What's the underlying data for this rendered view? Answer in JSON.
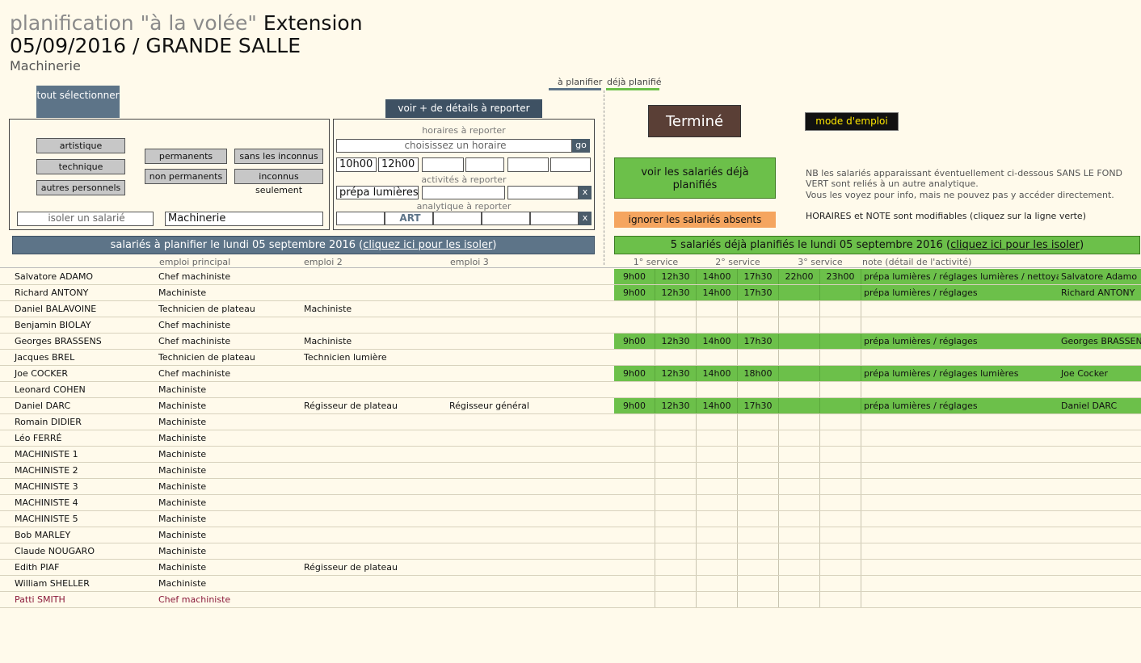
{
  "header": {
    "title_grey": "planification \"à la volée\"",
    "title_black": "Extension",
    "date_line": "05/09/2016 / GRANDE SALLE",
    "service": "Machinerie"
  },
  "legend": {
    "to_plan": "à planifier",
    "planned": "déjà planifié",
    "to_plan_color": "#5d7488",
    "planned_color": "#6cc04a"
  },
  "filters": {
    "select_all": "tout sélectionner",
    "details_tab": "voir + de détails à reporter",
    "categories": [
      "artistique",
      "technique",
      "autres personnels"
    ],
    "contract": [
      "permanents",
      "non permanents"
    ],
    "unknowns": [
      "sans les inconnus",
      "inconnus seulement"
    ],
    "isolate_placeholder": "isoler un salarié",
    "service_value": "Machinerie"
  },
  "report": {
    "hours_label": "horaires à reporter",
    "hours_placeholder": "choisissez un horaire",
    "go": "go",
    "hours": [
      "10h00",
      "12h00",
      "",
      "",
      "",
      ""
    ],
    "activities_label": "activités à reporter",
    "activities": [
      "prépa lumières",
      "",
      ""
    ],
    "analytic_label": "analytique à reporter",
    "analytic": [
      "",
      "ART",
      "",
      "",
      ""
    ],
    "clear": "x"
  },
  "actions": {
    "done": "Terminé",
    "help": "mode d'emploi",
    "see_planned": "voir les salariés déjà planifiés",
    "ignore_absent": "ignorer les salariés absents"
  },
  "notes": {
    "nb": "NB les salariés apparaissant éventuellement ci-dessous SANS LE FOND VERT sont reliés à un autre analytique.",
    "nb2": "Vous les voyez pour info, mais ne pouvez pas y accéder directement.",
    "editable": "HORAIRES et NOTE sont modifiables (cliquez sur la ligne verte)"
  },
  "left_panel": {
    "header_prefix": "salariés à planifier le lundi 05 septembre 2016 (",
    "header_link": "cliquez ici pour les isoler",
    "header_suffix": ")",
    "columns": [
      "emploi principal",
      "emploi 2",
      "emploi 3"
    ]
  },
  "right_panel": {
    "header_prefix": "5 salariés déjà planifiés le lundi 05 septembre 2016 (",
    "header_link": "cliquez ici pour les isoler",
    "header_suffix": ")",
    "columns": [
      "1° service",
      "2° service",
      "3° service",
      "note (détail de l'activité)"
    ]
  },
  "rows": [
    {
      "name": "Salvatore ADAMO",
      "job1": "Chef machiniste",
      "job2": "",
      "job3": "",
      "times": [
        "9h00",
        "12h30",
        "14h00",
        "17h30",
        "22h00",
        "23h00"
      ],
      "note": "prépa lumières / réglages lumières / nettoyage",
      "who": "Salvatore Adamo",
      "planned": true
    },
    {
      "name": "Richard ANTONY",
      "job1": "Machiniste",
      "job2": "",
      "job3": "",
      "times": [
        "9h00",
        "12h30",
        "14h00",
        "17h30",
        "",
        ""
      ],
      "note": "prépa lumières / réglages",
      "who": "Richard ANTONY",
      "planned": true
    },
    {
      "name": "Daniel BALAVOINE",
      "job1": "Technicien de plateau",
      "job2": "Machiniste",
      "job3": "",
      "times": [
        "",
        "",
        "",
        "",
        "",
        ""
      ],
      "note": "",
      "who": "",
      "planned": false
    },
    {
      "name": "Benjamin BIOLAY",
      "job1": "Chef machiniste",
      "job2": "",
      "job3": "",
      "times": [
        "",
        "",
        "",
        "",
        "",
        ""
      ],
      "note": "",
      "who": "",
      "planned": false
    },
    {
      "name": "Georges BRASSENS",
      "job1": "Chef machiniste",
      "job2": "Machiniste",
      "job3": "",
      "times": [
        "9h00",
        "12h30",
        "14h00",
        "17h30",
        "",
        ""
      ],
      "note": "prépa lumières / réglages",
      "who": "Georges BRASSENS",
      "planned": true
    },
    {
      "name": "Jacques BREL",
      "job1": "Technicien de plateau",
      "job2": "Technicien lumière",
      "job3": "",
      "times": [
        "",
        "",
        "",
        "",
        "",
        ""
      ],
      "note": "",
      "who": "",
      "planned": false
    },
    {
      "name": "Joe COCKER",
      "job1": "Chef machiniste",
      "job2": "",
      "job3": "",
      "times": [
        "9h00",
        "12h30",
        "14h00",
        "18h00",
        "",
        ""
      ],
      "note": "prépa lumières / réglages lumières",
      "who": "Joe Cocker",
      "planned": true
    },
    {
      "name": "Leonard COHEN",
      "job1": "Machiniste",
      "job2": "",
      "job3": "",
      "times": [
        "",
        "",
        "",
        "",
        "",
        ""
      ],
      "note": "",
      "who": "",
      "planned": false
    },
    {
      "name": "Daniel DARC",
      "job1": "Machiniste",
      "job2": "Régisseur de plateau",
      "job3": "Régisseur général",
      "times": [
        "9h00",
        "12h30",
        "14h00",
        "17h30",
        "",
        ""
      ],
      "note": "prépa lumières / réglages",
      "who": "Daniel DARC",
      "planned": true
    },
    {
      "name": "Romain DIDIER",
      "job1": "Machiniste",
      "job2": "",
      "job3": "",
      "times": [
        "",
        "",
        "",
        "",
        "",
        ""
      ],
      "note": "",
      "who": "",
      "planned": false
    },
    {
      "name": "Léo FERRÉ",
      "job1": "Machiniste",
      "job2": "",
      "job3": "",
      "times": [
        "",
        "",
        "",
        "",
        "",
        ""
      ],
      "note": "",
      "who": "",
      "planned": false
    },
    {
      "name": "MACHINISTE 1",
      "job1": "Machiniste",
      "job2": "",
      "job3": "",
      "times": [
        "",
        "",
        "",
        "",
        "",
        ""
      ],
      "note": "",
      "who": "",
      "planned": false
    },
    {
      "name": "MACHINISTE 2",
      "job1": "Machiniste",
      "job2": "",
      "job3": "",
      "times": [
        "",
        "",
        "",
        "",
        "",
        ""
      ],
      "note": "",
      "who": "",
      "planned": false
    },
    {
      "name": "MACHINISTE 3",
      "job1": "Machiniste",
      "job2": "",
      "job3": "",
      "times": [
        "",
        "",
        "",
        "",
        "",
        ""
      ],
      "note": "",
      "who": "",
      "planned": false
    },
    {
      "name": "MACHINISTE 4",
      "job1": "Machiniste",
      "job2": "",
      "job3": "",
      "times": [
        "",
        "",
        "",
        "",
        "",
        ""
      ],
      "note": "",
      "who": "",
      "planned": false
    },
    {
      "name": "MACHINISTE 5",
      "job1": "Machiniste",
      "job2": "",
      "job3": "",
      "times": [
        "",
        "",
        "",
        "",
        "",
        ""
      ],
      "note": "",
      "who": "",
      "planned": false
    },
    {
      "name": "Bob MARLEY",
      "job1": "Machiniste",
      "job2": "",
      "job3": "",
      "times": [
        "",
        "",
        "",
        "",
        "",
        ""
      ],
      "note": "",
      "who": "",
      "planned": false
    },
    {
      "name": "Claude NOUGARO",
      "job1": "Machiniste",
      "job2": "",
      "job3": "",
      "times": [
        "",
        "",
        "",
        "",
        "",
        ""
      ],
      "note": "",
      "who": "",
      "planned": false
    },
    {
      "name": "Edith PIAF",
      "job1": "Machiniste",
      "job2": "Régisseur de plateau",
      "job3": "",
      "times": [
        "",
        "",
        "",
        "",
        "",
        ""
      ],
      "note": "",
      "who": "",
      "planned": false
    },
    {
      "name": "William SHELLER",
      "job1": "Machiniste",
      "job2": "",
      "job3": "",
      "times": [
        "",
        "",
        "",
        "",
        "",
        ""
      ],
      "note": "",
      "who": "",
      "planned": false
    },
    {
      "name": "Patti SMITH",
      "job1": "Chef machiniste",
      "job2": "",
      "job3": "",
      "times": [
        "",
        "",
        "",
        "",
        "",
        ""
      ],
      "note": "",
      "who": "",
      "planned": false,
      "highlight": true
    }
  ]
}
